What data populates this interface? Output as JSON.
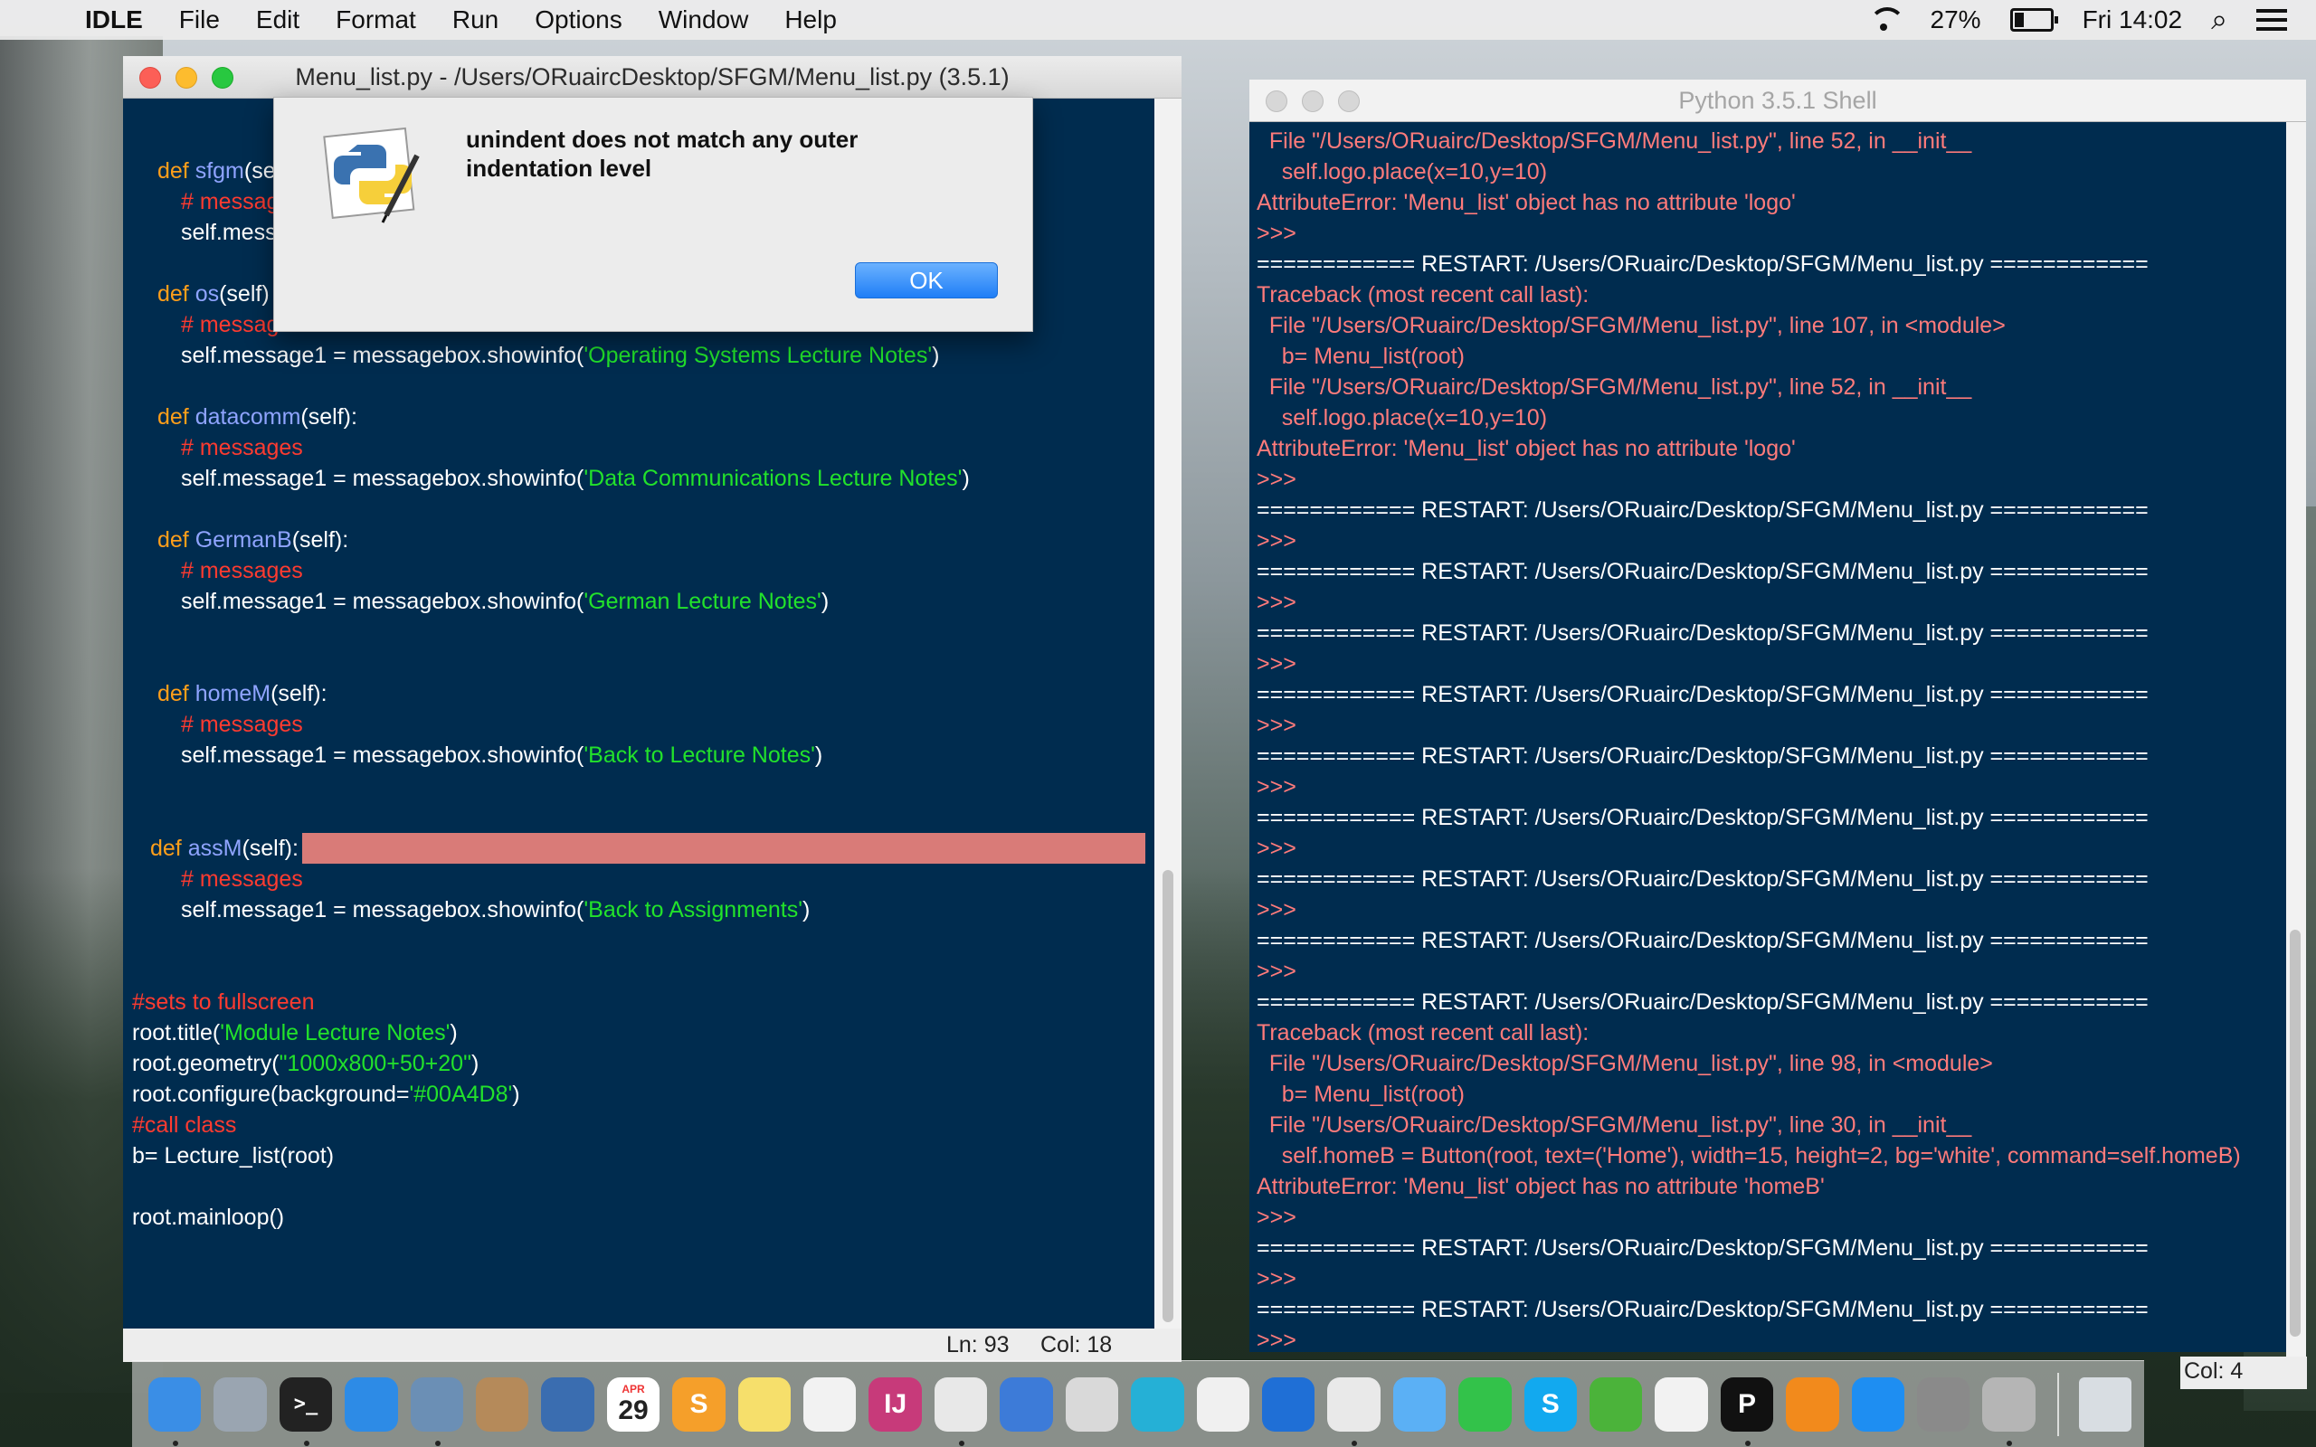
{
  "menubar": {
    "apple": "",
    "items": [
      "IDLE",
      "File",
      "Edit",
      "Format",
      "Run",
      "Options",
      "Window",
      "Help"
    ],
    "battery": "27%",
    "clock": "Fri 14:02"
  },
  "editor": {
    "title": "Menu_list.py - /Users/ORuaircDesktop/SFGM/Menu_list.py (3.5.1)",
    "status": {
      "line": "Ln: 93",
      "col": "Col: 18"
    },
    "lines": {
      "l1_kw": "def ",
      "l1_name": "sfgm",
      "l1_rest": "(se",
      "l2": "# messag",
      "l3": "self.mess",
      "l4_kw": "def ",
      "l4_name": "os",
      "l4_rest": "(self)",
      "l5": "# messag",
      "l6_a": "self.message1 = messagebox.showinfo(",
      "l6_s": "'Operating Systems Lecture Notes'",
      "l6_b": ")",
      "l7_kw": "def ",
      "l7_name": "datacomm",
      "l7_rest": "(self):",
      "l8": "# messages",
      "l9_a": "self.message1 = messagebox.showinfo(",
      "l9_s": "'Data Communications Lecture Notes'",
      "l9_b": ")",
      "l10_kw": "def ",
      "l10_name": "GermanB",
      "l10_rest": "(self):",
      "l11": "# messages",
      "l12_a": "self.message1 = messagebox.showinfo(",
      "l12_s": "'German Lecture Notes'",
      "l12_b": ")",
      "l13_kw": "def ",
      "l13_name": "homeM",
      "l13_rest": "(self):",
      "l14": "# messages",
      "l15_a": "self.message1 = messagebox.showinfo(",
      "l15_s": "'Back to Lecture Notes'",
      "l15_b": ")",
      "l16_kw": "def ",
      "l16_name": "assM",
      "l16_rest": "(self):",
      "l17": "# messages",
      "l18_a": "self.message1 = messagebox.showinfo(",
      "l18_s": "'Back to Assignments'",
      "l18_b": ")",
      "l19": "#sets to fullscreen",
      "l20_a": "root.title(",
      "l20_s": "'Module Lecture Notes'",
      "l20_b": ")",
      "l21_a": "root.geometry(",
      "l21_s": "\"1000x800+50+20\"",
      "l21_b": ")",
      "l22_a": "root.configure(background=",
      "l22_s": "'#00A4D8'",
      "l22_b": ")",
      "l23": "#call class",
      "l24": "b= Lecture_list(root)",
      "l25": "root.mainloop()"
    }
  },
  "dialog": {
    "message": "unindent does not match any outer indentation level",
    "ok_label": "OK"
  },
  "shell": {
    "title": "Python 3.5.1 Shell",
    "status_col": "Col: 4",
    "lines": [
      {
        "t": "  File \"/Users/ORuairc/Desktop/SFGM/Menu_list.py\", line 52, in __init__",
        "c": "err"
      },
      {
        "t": "    self.logo.place(x=10,y=10)",
        "c": "err"
      },
      {
        "t": "AttributeError: 'Menu_list' object has no attribute 'logo'",
        "c": "err"
      },
      {
        "t": ">>> ",
        "c": "err"
      },
      {
        "t": "============ RESTART: /Users/ORuairc/Desktop/SFGM/Menu_list.py ============",
        "c": "out"
      },
      {
        "t": "Traceback (most recent call last):",
        "c": "err"
      },
      {
        "t": "  File \"/Users/ORuairc/Desktop/SFGM/Menu_list.py\", line 107, in <module>",
        "c": "err"
      },
      {
        "t": "    b= Menu_list(root)",
        "c": "err"
      },
      {
        "t": "  File \"/Users/ORuairc/Desktop/SFGM/Menu_list.py\", line 52, in __init__",
        "c": "err"
      },
      {
        "t": "    self.logo.place(x=10,y=10)",
        "c": "err"
      },
      {
        "t": "AttributeError: 'Menu_list' object has no attribute 'logo'",
        "c": "err"
      },
      {
        "t": ">>> ",
        "c": "err"
      },
      {
        "t": "============ RESTART: /Users/ORuairc/Desktop/SFGM/Menu_list.py ============",
        "c": "out"
      },
      {
        "t": ">>> ",
        "c": "err"
      },
      {
        "t": "============ RESTART: /Users/ORuairc/Desktop/SFGM/Menu_list.py ============",
        "c": "out"
      },
      {
        "t": ">>> ",
        "c": "err"
      },
      {
        "t": "============ RESTART: /Users/ORuairc/Desktop/SFGM/Menu_list.py ============",
        "c": "out"
      },
      {
        "t": ">>> ",
        "c": "err"
      },
      {
        "t": "============ RESTART: /Users/ORuairc/Desktop/SFGM/Menu_list.py ============",
        "c": "out"
      },
      {
        "t": ">>> ",
        "c": "err"
      },
      {
        "t": "============ RESTART: /Users/ORuairc/Desktop/SFGM/Menu_list.py ============",
        "c": "out"
      },
      {
        "t": ">>> ",
        "c": "err"
      },
      {
        "t": "============ RESTART: /Users/ORuairc/Desktop/SFGM/Menu_list.py ============",
        "c": "out"
      },
      {
        "t": ">>> ",
        "c": "err"
      },
      {
        "t": "============ RESTART: /Users/ORuairc/Desktop/SFGM/Menu_list.py ============",
        "c": "out"
      },
      {
        "t": ">>> ",
        "c": "err"
      },
      {
        "t": "============ RESTART: /Users/ORuairc/Desktop/SFGM/Menu_list.py ============",
        "c": "out"
      },
      {
        "t": ">>> ",
        "c": "err"
      },
      {
        "t": "============ RESTART: /Users/ORuairc/Desktop/SFGM/Menu_list.py ============",
        "c": "out"
      },
      {
        "t": "Traceback (most recent call last):",
        "c": "err"
      },
      {
        "t": "  File \"/Users/ORuairc/Desktop/SFGM/Menu_list.py\", line 98, in <module>",
        "c": "err"
      },
      {
        "t": "    b= Menu_list(root)",
        "c": "err"
      },
      {
        "t": "  File \"/Users/ORuairc/Desktop/SFGM/Menu_list.py\", line 30, in __init__",
        "c": "err"
      },
      {
        "t": "    self.homeB = Button(root, text=('Home'), width=15, height=2, bg='white', command=self.homeB)",
        "c": "err"
      },
      {
        "t": "AttributeError: 'Menu_list' object has no attribute 'homeB'",
        "c": "err"
      },
      {
        "t": ">>> ",
        "c": "err"
      },
      {
        "t": "============ RESTART: /Users/ORuairc/Desktop/SFGM/Menu_list.py ============",
        "c": "out"
      },
      {
        "t": ">>> ",
        "c": "err"
      },
      {
        "t": "============ RESTART: /Users/ORuairc/Desktop/SFGM/Menu_list.py ============",
        "c": "out"
      },
      {
        "t": ">>> ",
        "c": "err"
      }
    ]
  },
  "dock": {
    "calendar_month": "APR",
    "calendar_day": "29",
    "terminal_glyph": ">_",
    "sublime_glyph": "S",
    "intellij_glyph": "IJ",
    "skype_glyph": "S",
    "pycharm_glyph": "P",
    "items": [
      {
        "name": "finder-icon",
        "color": "#3a8ee6"
      },
      {
        "name": "launchpad-icon",
        "color": "#9aa5b1"
      },
      {
        "name": "terminal-icon",
        "color": "#222222"
      },
      {
        "name": "safari-icon",
        "color": "#2d8be6"
      },
      {
        "name": "preview-icon",
        "color": "#6b8fb5"
      },
      {
        "name": "contacts-icon",
        "color": "#b58a5a"
      },
      {
        "name": "virtualbox-icon",
        "color": "#3a6db0"
      },
      {
        "name": "calendar-icon",
        "color": "#ffffff"
      },
      {
        "name": "sublime-text-icon",
        "color": "#f59f2a"
      },
      {
        "name": "notes-icon",
        "color": "#f6df6b"
      },
      {
        "name": "reminders-icon",
        "color": "#f2f2f2"
      },
      {
        "name": "intellij-icon",
        "color": "#c73a7a"
      },
      {
        "name": "python-launcher-icon",
        "color": "#e8e8e8"
      },
      {
        "name": "keynote-icon",
        "color": "#3d7bd8"
      },
      {
        "name": "image-capture-icon",
        "color": "#d9d9d9"
      },
      {
        "name": "webstorm-icon",
        "color": "#25b0d6"
      },
      {
        "name": "photos-icon",
        "color": "#f0f0f0"
      },
      {
        "name": "xcode-icon",
        "color": "#1f6fd6"
      },
      {
        "name": "chrome-icon",
        "color": "#e9e9e9"
      },
      {
        "name": "messages-icon",
        "color": "#5bb0f5"
      },
      {
        "name": "facetime-icon",
        "color": "#33c24a"
      },
      {
        "name": "skype-icon",
        "color": "#12a9ef"
      },
      {
        "name": "utorrent-icon",
        "color": "#4bb33a"
      },
      {
        "name": "itunes-icon",
        "color": "#f2f2f2"
      },
      {
        "name": "pycharm-icon",
        "color": "#111111"
      },
      {
        "name": "ibooks-icon",
        "color": "#f28a1c"
      },
      {
        "name": "app-store-icon",
        "color": "#1e8ef2"
      },
      {
        "name": "system-preferences-icon",
        "color": "#8a8a8a"
      },
      {
        "name": "rocket-icon",
        "color": "#b5b5b5"
      }
    ],
    "trash": {
      "name": "trash-icon",
      "color": "#d8dde2"
    }
  }
}
